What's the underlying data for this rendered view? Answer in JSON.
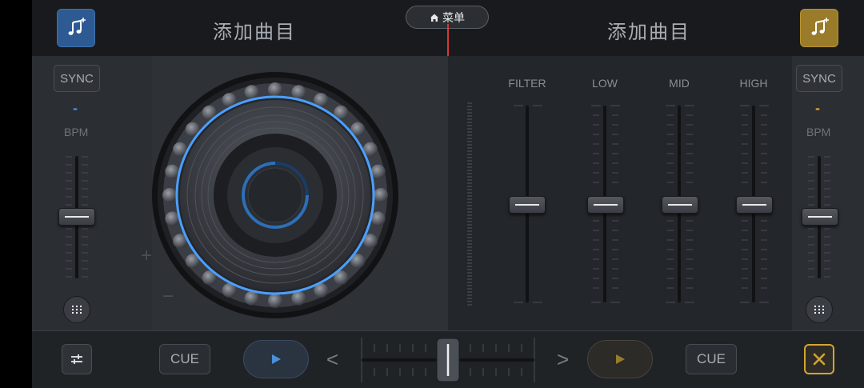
{
  "header": {
    "menu_label": "菜单",
    "left_deck_add_label": "添加曲目",
    "right_deck_add_label": "添加曲目"
  },
  "left_deck": {
    "sync_label": "SYNC",
    "bpm_value": "-",
    "bpm_label": "BPM",
    "pitch_plus": "+",
    "pitch_minus": "−",
    "cue_label": "CUE",
    "accent_color": "#4a90d9"
  },
  "right_deck": {
    "sync_label": "SYNC",
    "bpm_value": "-",
    "bpm_label": "BPM",
    "cue_label": "CUE",
    "accent_color": "#d4a532"
  },
  "mixer": {
    "eq_labels": [
      "FILTER",
      "LOW",
      "MID",
      "HIGH"
    ]
  },
  "crossfader": {
    "left_arrow": "<",
    "right_arrow": ">"
  },
  "icons": {
    "add_track": "music-note-plus-icon",
    "menu": "home-icon",
    "settings": "sliders-icon",
    "close": "close-icon",
    "play": "play-icon",
    "equalizer": "equalizer-dots-icon"
  }
}
